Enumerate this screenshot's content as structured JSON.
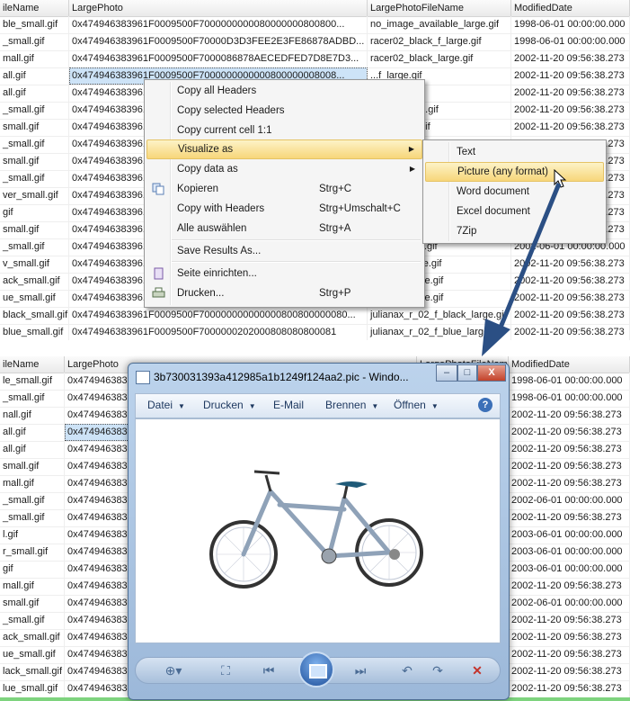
{
  "grid1": {
    "headers": [
      "ileName",
      "LargePhoto",
      "LargePhotoFileName",
      "ModifiedDate"
    ],
    "rows": [
      [
        "ble_small.gif",
        "0x47494638396​1F0009500F70000000000800000008008​00...",
        "no_image_available_large.gif",
        "1998-06-01 00:00:00.000"
      ],
      [
        "_small.gif",
        "0x47494638396​1F0009500F70000D3D3FEE2E3FE86878ADBD...",
        "racer02_black_f_large.gif",
        "1998-06-01 00:00:00.000"
      ],
      [
        "mall.gif",
        "0x47494638396​1F0009500F7000086878AECEDFED7D8E7D3...",
        "racer02_black_large.gif",
        "2002-11-20 09:56:38.273"
      ],
      [
        "all.gif",
        "0x47494638396​1F0009500F7000000000000800000008008...",
        "...f_large.gif",
        "2002-11-20 09:56:38.273"
      ],
      [
        "all.gif",
        "0x474946383961",
        "...e_large.gif",
        "2002-11-20 09:56:38.273"
      ],
      [
        "_small.gif",
        "0x474946383961",
        "...en_f_large.gif",
        "2002-11-20 09:56:38.273"
      ],
      [
        "small.gif",
        "0x474946383961",
        "...en_large.gif",
        "2002-11-20 09:56:38.273"
      ],
      [
        "_small.gif",
        "0x474946383961",
        "",
        "2002-11-20 09:56:38.273"
      ],
      [
        "small.gif",
        "0x474946383961",
        "",
        "2002-11-20 09:56:38.273"
      ],
      [
        "_small.gif",
        "0x474946383961",
        "",
        "2002-11-20 09:56:38.273"
      ],
      [
        "ver_small.gif",
        "0x474946383961",
        "",
        "2002-11-20 09:56:38.273"
      ],
      [
        "gif",
        "0x474946383961",
        "",
        "2002-11-20 09:56:38.273"
      ],
      [
        "small.gif",
        "0x474946383961",
        "",
        "2002-11-20 09:56:38.273"
      ],
      [
        "_small.gif",
        "0x474946383961",
        "...ilver_large.gif",
        "2002-06-01 00:00:00.000"
      ],
      [
        "v_small.gif",
        "0x474946383961",
        "...ellow_large.gif",
        "2002-11-20 09:56:38.273"
      ],
      [
        "ack_small.gif",
        "0x474946383961",
        "..._blue_large.gif",
        "2002-11-20 09:56:38.273"
      ],
      [
        "ue_small.gif",
        "0x474946383961",
        "..._blue_large.gif",
        "2002-11-20 09:56:38.273"
      ],
      [
        "black_small.gif",
        "0x47494638396​1F0009500F700000000000000800800000080...",
        "julianax_r_02_f_black_large.gif",
        "2002-11-20 09:56:38.273"
      ],
      [
        "blue_small.gif",
        "0x47494638396​1F0009500F7000000202000808080800081",
        "julianax_r_02_f_blue_large.gif",
        "2002-11-20 09:56:38.273"
      ]
    ]
  },
  "grid2": {
    "headers": [
      "ileName",
      "LargePhoto",
      "LargePhotoFileName",
      "ModifiedDate"
    ],
    "rows": [
      [
        "le_small.gif",
        "0x474946383",
        "1998-06-01 00:00:00.000"
      ],
      [
        "_small.gif",
        "0x474946383",
        "1998-06-01 00:00:00.000"
      ],
      [
        "nall.gif",
        "0x474946383",
        "2002-11-20 09:56:38.273"
      ],
      [
        "all.gif",
        "0x474946383",
        "2002-11-20 09:56:38.273"
      ],
      [
        "all.gif",
        "0x474946383",
        "2002-11-20 09:56:38.273"
      ],
      [
        "small.gif",
        "0x474946383",
        "2002-11-20 09:56:38.273"
      ],
      [
        "mall.gif",
        "0x474946383",
        "2002-11-20 09:56:38.273"
      ],
      [
        "_small.gif",
        "0x474946383",
        "2002-06-01 00:00:00.000"
      ],
      [
        "_small.gif",
        "0x474946383",
        "2002-11-20 09:56:38.273"
      ],
      [
        "l.gif",
        "0x474946383",
        "2003-06-01 00:00:00.000"
      ],
      [
        "r_small.gif",
        "0x474946383",
        "2003-06-01 00:00:00.000"
      ],
      [
        "gif",
        "0x474946383",
        "2003-06-01 00:00:00.000"
      ],
      [
        "mall.gif",
        "0x474946383",
        "2002-11-20 09:56:38.273"
      ],
      [
        "small.gif",
        "0x474946383",
        "2002-06-01 00:00:00.000"
      ],
      [
        "_small.gif",
        "0x474946383",
        "2002-11-20 09:56:38.273"
      ],
      [
        "ack_small.gif",
        "0x474946383",
        "2002-11-20 09:56:38.273"
      ],
      [
        "ue_small.gif",
        "0x474946383",
        "2002-11-20 09:56:38.273"
      ],
      [
        "lack_small.gif",
        "0x474946383",
        "2002-11-20 09:56:38.273"
      ],
      [
        "lue_small.gif",
        "0x474946383",
        "2002-11-20 09:56:38.273"
      ]
    ]
  },
  "context_menu": {
    "items": [
      {
        "label": "Copy all Headers",
        "shortcut": ""
      },
      {
        "label": "Copy selected Headers",
        "shortcut": ""
      },
      {
        "label": "Copy current cell 1:1",
        "shortcut": ""
      },
      {
        "label": "Visualize as",
        "shortcut": ""
      },
      {
        "label": "Copy data as",
        "shortcut": ""
      },
      {
        "label": "Kopieren",
        "shortcut": "Strg+C"
      },
      {
        "label": "Copy with Headers",
        "shortcut": "Strg+Umschalt+C"
      },
      {
        "label": "Alle auswählen",
        "shortcut": "Strg+A"
      },
      {
        "label": "Save Results As...",
        "shortcut": ""
      },
      {
        "label": "Seite einrichten...",
        "shortcut": ""
      },
      {
        "label": "Drucken...",
        "shortcut": "Strg+P"
      }
    ],
    "submenu_arrow": "▶"
  },
  "submenu": {
    "items": [
      "Text",
      "Picture (any format)",
      "Word document",
      "Excel document",
      "7Zip"
    ]
  },
  "viewer": {
    "title": "3b730031393a412985a1b1249f124aa2.pic - Windo...",
    "window_buttons": [
      "–",
      "□",
      "X"
    ],
    "toolbar": [
      {
        "label": "Datei",
        "has_dropdown": true
      },
      {
        "label": "Drucken",
        "has_dropdown": true
      },
      {
        "label": "E-Mail",
        "has_dropdown": false
      },
      {
        "label": "Brennen",
        "has_dropdown": true
      },
      {
        "label": "Öffnen",
        "has_dropdown": true
      }
    ],
    "help": "?",
    "icons": {
      "zoom": "zoom-icon",
      "fit": "actual-size-icon",
      "prev": "previous-icon",
      "slideshow": "slideshow-icon",
      "next": "next-icon",
      "rotate_left": "rotate-left-icon",
      "rotate_right": "rotate-right-icon",
      "delete": "delete-icon"
    }
  },
  "colors": {
    "selection": "#cde3f7",
    "menu_highlight": "#f7d67a",
    "arrow": "#2b4f84",
    "status_green": "#7ed37e"
  }
}
